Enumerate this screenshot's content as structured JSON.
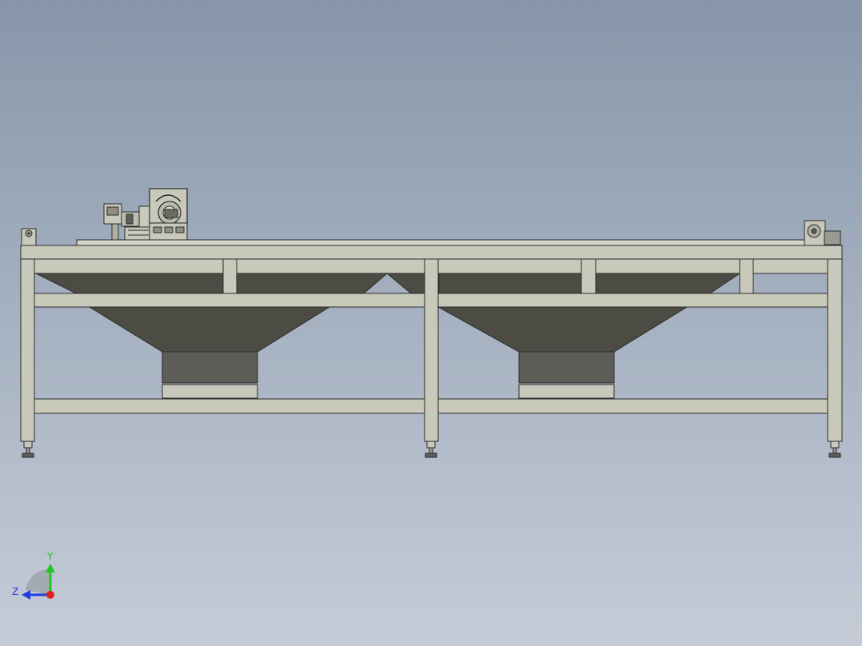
{
  "colors": {
    "background_top": "#8796a9",
    "background_bottom": "#c5ccd8",
    "frame_fill": "#c9c9bb",
    "frame_stroke": "#2b2b2b",
    "hopper_fill": "#4c4c44",
    "hopper_box_fill": "#5e5e58",
    "axis_x": "#e0201a",
    "axis_y": "#1ec61e",
    "axis_z": "#1e3ce0"
  },
  "triad": {
    "y_label": "Y",
    "z_label": "Z",
    "origin_icon": "red-dot-origin"
  },
  "model": {
    "icons": [
      "drive-motor-icon",
      "gearbox-icon",
      "tail-pulley-icon",
      "leveling-foot-icon"
    ]
  }
}
